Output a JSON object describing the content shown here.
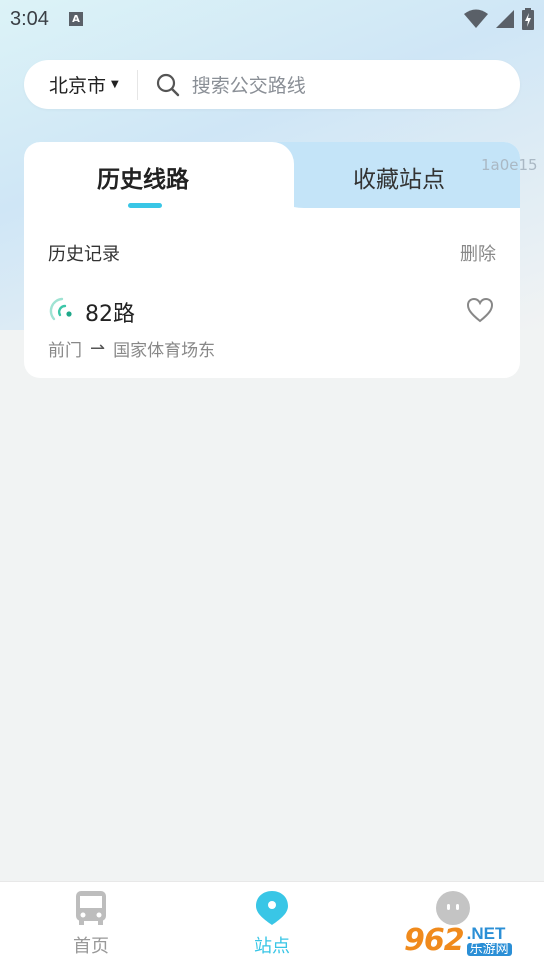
{
  "status_bar": {
    "time": "3:04",
    "notification_letter": "A"
  },
  "search": {
    "city": "北京市",
    "placeholder": "搜索公交路线"
  },
  "tabs": [
    {
      "label": "历史线路",
      "active": true
    },
    {
      "label": "收藏站点",
      "active": false
    }
  ],
  "overlay_id": "1a0e15",
  "history": {
    "title": "历史记录",
    "delete_label": "删除",
    "items": [
      {
        "route": "82路",
        "from": "前门",
        "to": "国家体育场东",
        "favorited": false
      }
    ]
  },
  "bottom_nav": [
    {
      "label": "首页",
      "icon": "bus-icon",
      "active": false
    },
    {
      "label": "站点",
      "icon": "location-pin-icon",
      "active": true
    },
    {
      "label": "",
      "icon": "profile-face-icon",
      "active": false
    }
  ],
  "brand_watermark": {
    "number": "962",
    "net": ".NET",
    "chinese": "乐游网"
  },
  "colors": {
    "accent": "#39c6e6",
    "tab_inactive_bg": "#c4e4f8",
    "brand_orange": "#f08a1c",
    "brand_blue": "#2b8fd6"
  }
}
